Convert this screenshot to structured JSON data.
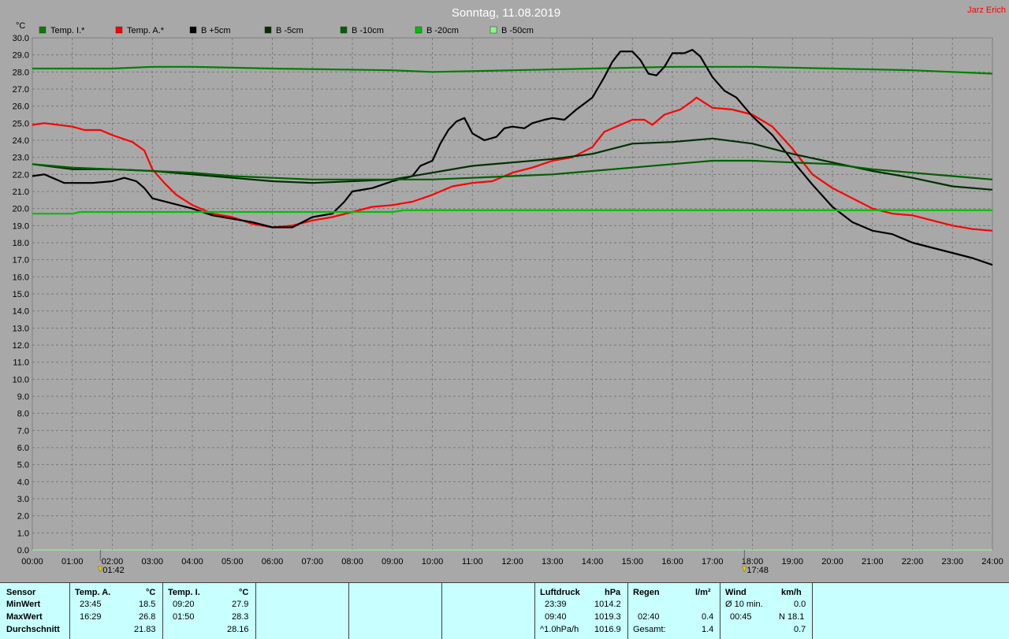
{
  "chart_data": {
    "type": "line",
    "title": "Sonntag, 11.08.2019",
    "author": "Jarz Erich",
    "ylabel": "°C",
    "ylim": [
      0,
      30
    ],
    "xlim": [
      0,
      24
    ],
    "x_unit": "hours",
    "y_ticks": [
      "0.0",
      "1.0",
      "2.0",
      "3.0",
      "4.0",
      "5.0",
      "6.0",
      "7.0",
      "8.0",
      "9.0",
      "10.0",
      "11.0",
      "12.0",
      "13.0",
      "14.0",
      "15.0",
      "16.0",
      "17.0",
      "18.0",
      "19.0",
      "20.0",
      "21.0",
      "22.0",
      "23.0",
      "24.0",
      "25.0",
      "26.0",
      "27.0",
      "28.0",
      "29.0",
      "30.0"
    ],
    "x_ticks": [
      "00:00",
      "01:00",
      "02:00",
      "03:00",
      "04:00",
      "05:00",
      "06:00",
      "07:00",
      "08:00",
      "09:00",
      "10:00",
      "11:00",
      "12:00",
      "13:00",
      "14:00",
      "15:00",
      "16:00",
      "17:00",
      "18:00",
      "19:00",
      "20:00",
      "21:00",
      "22:00",
      "23:00",
      "24:00"
    ],
    "grid": true,
    "legend_position": "top",
    "markers": [
      {
        "x": 1.7,
        "label": "01:42",
        "color": "#e8c800"
      },
      {
        "x": 17.8,
        "label": "17:48",
        "color": "#e8c800"
      }
    ],
    "series": [
      {
        "name": "Temp. I.*",
        "color": "#008000",
        "points": [
          [
            0,
            28.2
          ],
          [
            2,
            28.2
          ],
          [
            3,
            28.3
          ],
          [
            4,
            28.3
          ],
          [
            6,
            28.2
          ],
          [
            9,
            28.1
          ],
          [
            10,
            28.0
          ],
          [
            12,
            28.1
          ],
          [
            14,
            28.2
          ],
          [
            16,
            28.3
          ],
          [
            18,
            28.3
          ],
          [
            20,
            28.2
          ],
          [
            22,
            28.1
          ],
          [
            23,
            28.0
          ],
          [
            24,
            27.9
          ]
        ]
      },
      {
        "name": "Temp. A.*",
        "color": "#ff0000",
        "points": [
          [
            0,
            24.9
          ],
          [
            0.3,
            25.0
          ],
          [
            1,
            24.8
          ],
          [
            1.3,
            24.6
          ],
          [
            1.7,
            24.6
          ],
          [
            2,
            24.3
          ],
          [
            2.5,
            23.9
          ],
          [
            2.8,
            23.4
          ],
          [
            3,
            22.3
          ],
          [
            3.3,
            21.5
          ],
          [
            3.6,
            20.8
          ],
          [
            4,
            20.2
          ],
          [
            4.5,
            19.7
          ],
          [
            5,
            19.5
          ],
          [
            5.5,
            19.1
          ],
          [
            6,
            18.9
          ],
          [
            6.5,
            19.0
          ],
          [
            7,
            19.3
          ],
          [
            7.5,
            19.5
          ],
          [
            8,
            19.8
          ],
          [
            8.5,
            20.1
          ],
          [
            9,
            20.2
          ],
          [
            9.5,
            20.4
          ],
          [
            10,
            20.8
          ],
          [
            10.5,
            21.3
          ],
          [
            11,
            21.5
          ],
          [
            11.5,
            21.6
          ],
          [
            12,
            22.1
          ],
          [
            12.5,
            22.4
          ],
          [
            13,
            22.8
          ],
          [
            13.5,
            23.0
          ],
          [
            14,
            23.6
          ],
          [
            14.3,
            24.5
          ],
          [
            14.7,
            24.9
          ],
          [
            15,
            25.2
          ],
          [
            15.3,
            25.2
          ],
          [
            15.5,
            24.9
          ],
          [
            15.8,
            25.5
          ],
          [
            16.2,
            25.8
          ],
          [
            16.5,
            26.3
          ],
          [
            16.6,
            26.5
          ],
          [
            16.8,
            26.2
          ],
          [
            17,
            25.9
          ],
          [
            17.5,
            25.8
          ],
          [
            18,
            25.5
          ],
          [
            18.5,
            24.8
          ],
          [
            19,
            23.5
          ],
          [
            19.5,
            22.0
          ],
          [
            20,
            21.2
          ],
          [
            20.5,
            20.6
          ],
          [
            21,
            20.0
          ],
          [
            21.5,
            19.7
          ],
          [
            22,
            19.6
          ],
          [
            22.5,
            19.3
          ],
          [
            23,
            19.0
          ],
          [
            23.5,
            18.8
          ],
          [
            24,
            18.7
          ]
        ]
      },
      {
        "name": "B +5cm",
        "color": "#000000",
        "points": [
          [
            0,
            21.9
          ],
          [
            0.3,
            22.0
          ],
          [
            0.8,
            21.5
          ],
          [
            1.5,
            21.5
          ],
          [
            2,
            21.6
          ],
          [
            2.3,
            21.8
          ],
          [
            2.6,
            21.6
          ],
          [
            2.8,
            21.2
          ],
          [
            3,
            20.6
          ],
          [
            3.5,
            20.3
          ],
          [
            4,
            20.0
          ],
          [
            4.5,
            19.6
          ],
          [
            5,
            19.4
          ],
          [
            5.5,
            19.2
          ],
          [
            6,
            18.9
          ],
          [
            6.5,
            18.9
          ],
          [
            7,
            19.5
          ],
          [
            7.5,
            19.7
          ],
          [
            7.8,
            20.4
          ],
          [
            8,
            21.0
          ],
          [
            8.5,
            21.2
          ],
          [
            9,
            21.6
          ],
          [
            9.5,
            21.9
          ],
          [
            9.7,
            22.5
          ],
          [
            10,
            22.8
          ],
          [
            10.2,
            23.8
          ],
          [
            10.4,
            24.6
          ],
          [
            10.6,
            25.1
          ],
          [
            10.8,
            25.3
          ],
          [
            11,
            24.4
          ],
          [
            11.3,
            24.0
          ],
          [
            11.6,
            24.2
          ],
          [
            11.8,
            24.7
          ],
          [
            12,
            24.8
          ],
          [
            12.3,
            24.7
          ],
          [
            12.5,
            25.0
          ],
          [
            12.8,
            25.2
          ],
          [
            13,
            25.3
          ],
          [
            13.3,
            25.2
          ],
          [
            13.6,
            25.8
          ],
          [
            14,
            26.5
          ],
          [
            14.3,
            27.7
          ],
          [
            14.5,
            28.6
          ],
          [
            14.7,
            29.2
          ],
          [
            15,
            29.2
          ],
          [
            15.2,
            28.7
          ],
          [
            15.4,
            27.9
          ],
          [
            15.6,
            27.8
          ],
          [
            15.8,
            28.3
          ],
          [
            16,
            29.1
          ],
          [
            16.3,
            29.1
          ],
          [
            16.5,
            29.3
          ],
          [
            16.7,
            28.9
          ],
          [
            17,
            27.7
          ],
          [
            17.3,
            26.9
          ],
          [
            17.6,
            26.5
          ],
          [
            18,
            25.4
          ],
          [
            18.5,
            24.3
          ],
          [
            19,
            22.8
          ],
          [
            19.5,
            21.4
          ],
          [
            20,
            20.1
          ],
          [
            20.5,
            19.2
          ],
          [
            21,
            18.7
          ],
          [
            21.5,
            18.5
          ],
          [
            22,
            18.0
          ],
          [
            22.5,
            17.7
          ],
          [
            23,
            17.4
          ],
          [
            23.5,
            17.1
          ],
          [
            24,
            16.7
          ]
        ]
      },
      {
        "name": "B -5cm",
        "color": "#003000",
        "points": [
          [
            0,
            22.6
          ],
          [
            1,
            22.3
          ],
          [
            2,
            22.3
          ],
          [
            3,
            22.2
          ],
          [
            4,
            22.0
          ],
          [
            5,
            21.8
          ],
          [
            6,
            21.6
          ],
          [
            7,
            21.5
          ],
          [
            8,
            21.6
          ],
          [
            9,
            21.7
          ],
          [
            10,
            22.1
          ],
          [
            11,
            22.5
          ],
          [
            12,
            22.7
          ],
          [
            13,
            22.9
          ],
          [
            14,
            23.2
          ],
          [
            15,
            23.8
          ],
          [
            16,
            23.9
          ],
          [
            17,
            24.1
          ],
          [
            18,
            23.8
          ],
          [
            19,
            23.2
          ],
          [
            20,
            22.7
          ],
          [
            21,
            22.2
          ],
          [
            22,
            21.8
          ],
          [
            23,
            21.3
          ],
          [
            24,
            21.1
          ]
        ]
      },
      {
        "name": "B -10cm",
        "color": "#006000",
        "points": [
          [
            0,
            22.6
          ],
          [
            1,
            22.4
          ],
          [
            2,
            22.3
          ],
          [
            3,
            22.2
          ],
          [
            4,
            22.1
          ],
          [
            5,
            21.9
          ],
          [
            6,
            21.8
          ],
          [
            7,
            21.7
          ],
          [
            8,
            21.7
          ],
          [
            9,
            21.7
          ],
          [
            10,
            21.7
          ],
          [
            11,
            21.8
          ],
          [
            12,
            21.9
          ],
          [
            13,
            22.0
          ],
          [
            14,
            22.2
          ],
          [
            15,
            22.4
          ],
          [
            16,
            22.6
          ],
          [
            17,
            22.8
          ],
          [
            18,
            22.8
          ],
          [
            19,
            22.7
          ],
          [
            20,
            22.6
          ],
          [
            21,
            22.3
          ],
          [
            22,
            22.1
          ],
          [
            23,
            21.9
          ],
          [
            24,
            21.7
          ]
        ]
      },
      {
        "name": "B -20cm",
        "color": "#00c000",
        "points": [
          [
            0,
            19.7
          ],
          [
            1,
            19.7
          ],
          [
            1.2,
            19.8
          ],
          [
            3,
            19.8
          ],
          [
            6,
            19.8
          ],
          [
            8,
            19.8
          ],
          [
            9,
            19.8
          ],
          [
            9.3,
            19.9
          ],
          [
            12,
            19.9
          ],
          [
            18,
            19.9
          ],
          [
            24,
            19.9
          ]
        ]
      },
      {
        "name": "B -50cm",
        "color": "#80ff80",
        "points": []
      }
    ]
  },
  "stats": {
    "col_sensor": {
      "header": "Sensor",
      "min": "MinWert",
      "max": "MaxWert",
      "avg": "Durchschnitt"
    },
    "col_temp_a": {
      "header": "Temp. A.",
      "unit": "°C",
      "min_time": "23:45",
      "min_val": "18.5",
      "max_time": "16:29",
      "max_val": "26.8",
      "avg_val": "21.83"
    },
    "col_temp_i": {
      "header": "Temp. I.",
      "unit": "°C",
      "min_time": "09:20",
      "min_val": "27.9",
      "max_time": "01:50",
      "max_val": "28.3",
      "avg_val": "28.16"
    },
    "col_pressure": {
      "header": "Luftdruck",
      "unit": "hPa",
      "min_time": "23:39",
      "min_val": "1014.2",
      "max_time": "09:40",
      "max_val": "1019.3",
      "trend_label": "^1.0hPa/h",
      "trend_val": "1016.9"
    },
    "col_rain": {
      "header": "Regen",
      "unit": "l/m²",
      "max_time": "02:40",
      "max_val": "0.4",
      "total_label": "Gesamt:",
      "total_val": "1.4"
    },
    "col_wind": {
      "header": "Wind",
      "unit": "km/h",
      "min_label": "Ø 10 min.",
      "min_val": "0.0",
      "max_time": "00:45",
      "max_val": "N 18.1",
      "avg_val": "0.7"
    }
  }
}
